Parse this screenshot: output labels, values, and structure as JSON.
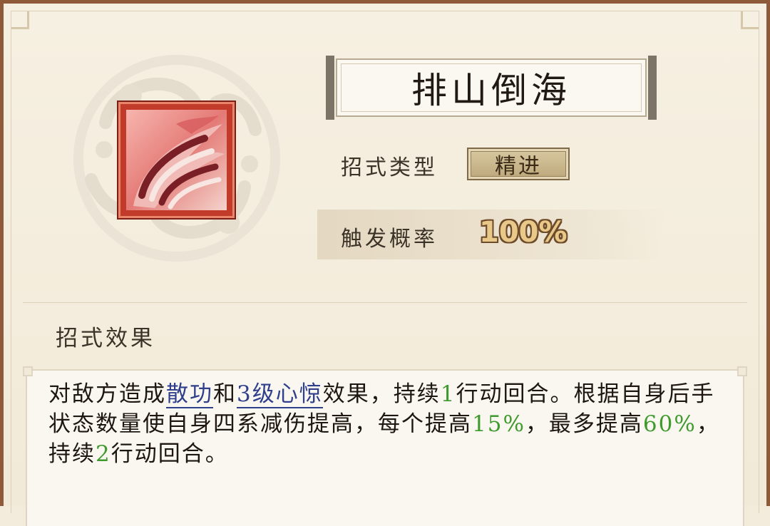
{
  "skill": {
    "name": "排山倒海",
    "type_label": "招式类型",
    "type_value": "精进",
    "rate_label": "触发概率",
    "rate_value": "100%"
  },
  "effect": {
    "heading": "招式效果",
    "segments": [
      {
        "text": "对敌方造成",
        "style": "plain"
      },
      {
        "text": "散功",
        "style": "keyword"
      },
      {
        "text": "和",
        "style": "plain"
      },
      {
        "text": "3级心惊",
        "style": "keyword"
      },
      {
        "text": "效果，持续",
        "style": "plain"
      },
      {
        "text": "1",
        "style": "number"
      },
      {
        "text": "行动回合。根据自身后手状态数量使自身四系减伤提高，每个提高",
        "style": "plain"
      },
      {
        "text": "15%",
        "style": "number"
      },
      {
        "text": "，最多提高",
        "style": "plain"
      },
      {
        "text": "60%",
        "style": "number"
      },
      {
        "text": "，持续",
        "style": "plain"
      },
      {
        "text": "2",
        "style": "number"
      },
      {
        "text": "行动回合。",
        "style": "plain"
      }
    ]
  },
  "icons": {
    "skill_icon": "crimson-wave-slash-icon",
    "background_emblem": "cloud-swirl-emblem"
  },
  "colors": {
    "frame": "#8f5a3a",
    "keyword": "#2f3f8c",
    "number": "#3f9a2e",
    "rate_value": "#e9c98a"
  }
}
